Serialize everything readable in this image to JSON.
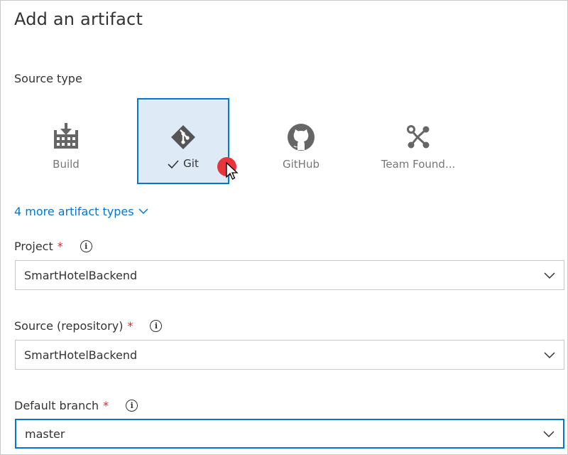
{
  "title": "Add an artifact",
  "source_type": {
    "label": "Source type",
    "tiles": [
      {
        "label": "Build",
        "icon": "build-icon",
        "selected": false
      },
      {
        "label": "Git",
        "icon": "git-icon",
        "selected": true
      },
      {
        "label": "GitHub",
        "icon": "github-icon",
        "selected": false
      },
      {
        "label": "Team Found...",
        "icon": "team-foundation-icon",
        "selected": false
      }
    ],
    "more_link": "4 more artifact types"
  },
  "fields": {
    "project": {
      "label": "Project",
      "required": "*",
      "value": "SmartHotelBackend"
    },
    "source": {
      "label": "Source (repository)",
      "required": "*",
      "value": "SmartHotelBackend"
    },
    "branch": {
      "label": "Default branch",
      "required": "*",
      "value": "master"
    }
  },
  "colors": {
    "accent": "#0078d4",
    "selected_bg": "#deebf7",
    "required": "#e0242a",
    "cursor_dot": "#e8353c"
  }
}
